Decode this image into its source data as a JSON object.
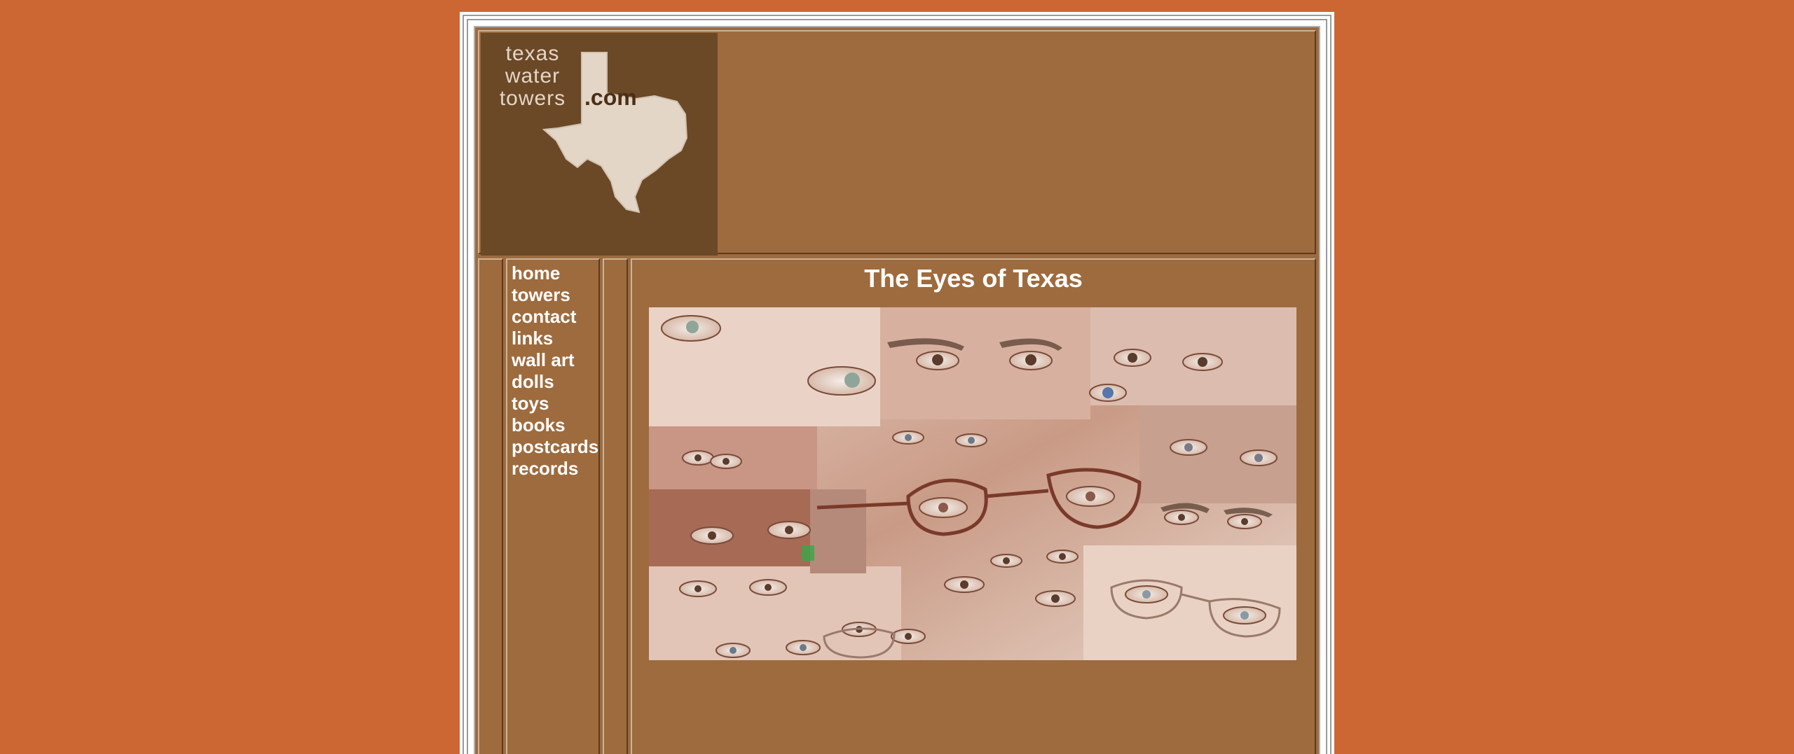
{
  "colors": {
    "page_background": "#cc6633",
    "content_background": "#9e6b3e",
    "logo_background": "#6b4826",
    "nav_text": "#ffffff"
  },
  "logo": {
    "line1": "texas",
    "line2": "water",
    "line3": "towers",
    "suffix": ".com"
  },
  "nav": {
    "items": [
      {
        "label": "home"
      },
      {
        "label": "towers"
      },
      {
        "label": "contact"
      },
      {
        "label": "links"
      },
      {
        "label": "wall art"
      },
      {
        "label": "dolls"
      },
      {
        "label": "toys"
      },
      {
        "label": "books"
      },
      {
        "label": "postcards"
      },
      {
        "label": "records"
      }
    ]
  },
  "main": {
    "title": "The Eyes of Texas",
    "image_icon": "eyes-collage-image"
  }
}
